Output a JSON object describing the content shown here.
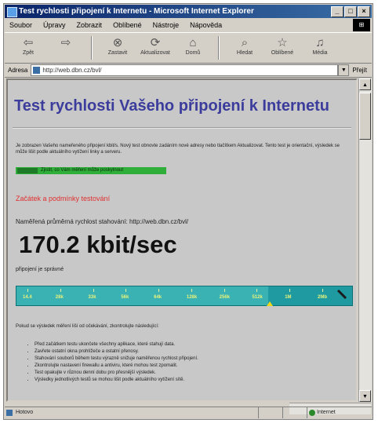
{
  "window": {
    "title": "Test rychlosti připojení k Internetu - Microsoft Internet Explorer",
    "controls": [
      "_",
      "□",
      "×"
    ]
  },
  "menu": {
    "items": [
      "Soubor",
      "Úpravy",
      "Zobrazit",
      "Oblíbené",
      "Nástroje",
      "Nápověda"
    ]
  },
  "toolbar": {
    "buttons": [
      {
        "label": "Zpět",
        "icon": "back-arrow-icon"
      },
      {
        "label": "",
        "icon": "forward-arrow-icon"
      },
      {
        "label": "Zastavit",
        "icon": "stop-icon"
      },
      {
        "label": "Aktualizovat",
        "icon": "refresh-icon"
      },
      {
        "label": "Domů",
        "icon": "home-icon"
      },
      {
        "label": "Hledat",
        "icon": "search-icon"
      },
      {
        "label": "Oblíbené",
        "icon": "favorites-icon"
      },
      {
        "label": "Média",
        "icon": "media-icon"
      }
    ]
  },
  "address": {
    "label": "Adresa",
    "url": "http://web.dbn.cz/bvl/",
    "go": "Přejít"
  },
  "page": {
    "title": "Test rychlosti Vašeho připojení k Internetu",
    "intro": "Je zobrazen Vašeho nameřeného připojení kbit/s. Nový test obnovte zadáním nové adresy nebo tlačítkem Aktualizovat. Tento test je orientační, výsledek se může lišit podle aktuálního vytížení linky a serveru.",
    "green_link": "Zjistit, co Vám měření může poskytnout",
    "red_link": "Začátek a podmínky testování",
    "measure_line": "Naměřená průměrná rychlost stahování: http://web.dbn.cz/bvl/",
    "speed": "170.2 kbit/sec",
    "connected": "připojení je správné",
    "note": "Pokud se výsledek měření liší od očekávání, zkontrolujte následující:",
    "bullets": [
      "Před začátkem testu ukončete všechny aplikace, které stahují data.",
      "Zavřete ostatní okna prohlížeče a ostatní přenosy.",
      "Stahování souborů během testu výrazně snižuje naměřenou rychlost připojení.",
      "Zkontrolujte nastavení firewallu a antiviru, které mohou test zpomalit.",
      "Test opakujte v různou denní dobu pro přesnější výsledek.",
      "Výsledky jednotlivých testů se mohou lišit podle aktuálního vytížení sítě."
    ]
  },
  "gauge": {
    "labels": [
      "14.4",
      "28k",
      "33k",
      "56k",
      "64k",
      "128k",
      "256k",
      "512k",
      "1M",
      "2Mb"
    ],
    "current_kbit": 170.2,
    "fill_fraction": 0.75,
    "color": "#1e9aa0",
    "label_color": "#e8f27a",
    "marker_color": "#f2d81a"
  },
  "status": {
    "text": "Hotovo",
    "zone": "Internet"
  },
  "colors": {
    "title": "#3c3c9c",
    "green_bar": "#2fae3a",
    "red_link": "#e03030",
    "titlebar": "#0a246a"
  }
}
